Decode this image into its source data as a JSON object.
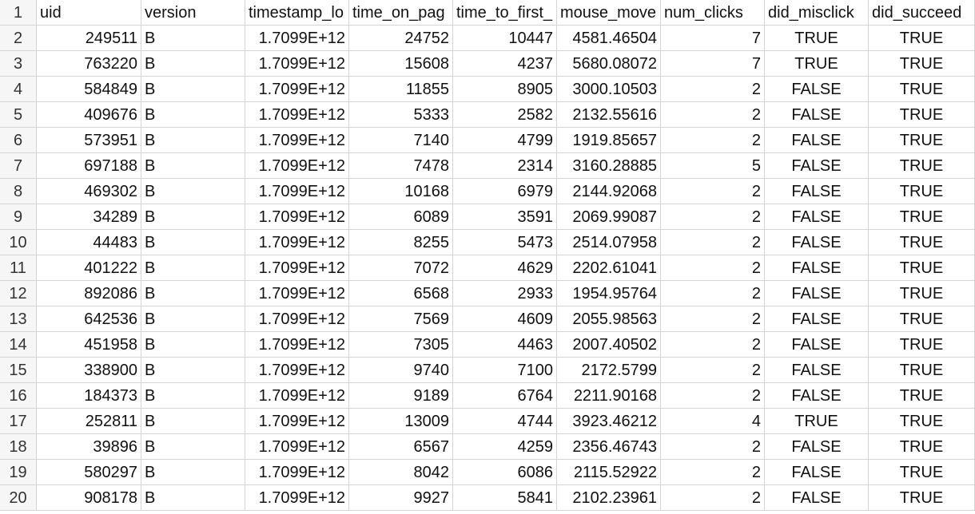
{
  "sheet": {
    "columns": [
      "uid",
      "version",
      "timestamp_lo",
      "time_on_pag",
      "time_to_first_",
      "mouse_move",
      "num_clicks",
      "did_misclick",
      "did_succeed"
    ],
    "rows": [
      [
        "249511",
        "B",
        "1.7099E+12",
        "24752",
        "10447",
        "4581.46504",
        "7",
        "TRUE",
        "TRUE"
      ],
      [
        "763220",
        "B",
        "1.7099E+12",
        "15608",
        "4237",
        "5680.08072",
        "7",
        "TRUE",
        "TRUE"
      ],
      [
        "584849",
        "B",
        "1.7099E+12",
        "11855",
        "8905",
        "3000.10503",
        "2",
        "FALSE",
        "TRUE"
      ],
      [
        "409676",
        "B",
        "1.7099E+12",
        "5333",
        "2582",
        "2132.55616",
        "2",
        "FALSE",
        "TRUE"
      ],
      [
        "573951",
        "B",
        "1.7099E+12",
        "7140",
        "4799",
        "1919.85657",
        "2",
        "FALSE",
        "TRUE"
      ],
      [
        "697188",
        "B",
        "1.7099E+12",
        "7478",
        "2314",
        "3160.28885",
        "5",
        "FALSE",
        "TRUE"
      ],
      [
        "469302",
        "B",
        "1.7099E+12",
        "10168",
        "6979",
        "2144.92068",
        "2",
        "FALSE",
        "TRUE"
      ],
      [
        "34289",
        "B",
        "1.7099E+12",
        "6089",
        "3591",
        "2069.99087",
        "2",
        "FALSE",
        "TRUE"
      ],
      [
        "44483",
        "B",
        "1.7099E+12",
        "8255",
        "5473",
        "2514.07958",
        "2",
        "FALSE",
        "TRUE"
      ],
      [
        "401222",
        "B",
        "1.7099E+12",
        "7072",
        "4629",
        "2202.61041",
        "2",
        "FALSE",
        "TRUE"
      ],
      [
        "892086",
        "B",
        "1.7099E+12",
        "6568",
        "2933",
        "1954.95764",
        "2",
        "FALSE",
        "TRUE"
      ],
      [
        "642536",
        "B",
        "1.7099E+12",
        "7569",
        "4609",
        "2055.98563",
        "2",
        "FALSE",
        "TRUE"
      ],
      [
        "451958",
        "B",
        "1.7099E+12",
        "7305",
        "4463",
        "2007.40502",
        "2",
        "FALSE",
        "TRUE"
      ],
      [
        "338900",
        "B",
        "1.7099E+12",
        "9740",
        "7100",
        "2172.5799",
        "2",
        "FALSE",
        "TRUE"
      ],
      [
        "184373",
        "B",
        "1.7099E+12",
        "9189",
        "6764",
        "2211.90168",
        "2",
        "FALSE",
        "TRUE"
      ],
      [
        "252811",
        "B",
        "1.7099E+12",
        "13009",
        "4744",
        "3923.46212",
        "4",
        "TRUE",
        "TRUE"
      ],
      [
        "39896",
        "B",
        "1.7099E+12",
        "6567",
        "4259",
        "2356.46743",
        "2",
        "FALSE",
        "TRUE"
      ],
      [
        "580297",
        "B",
        "1.7099E+12",
        "8042",
        "6086",
        "2115.52922",
        "2",
        "FALSE",
        "TRUE"
      ],
      [
        "908178",
        "B",
        "1.7099E+12",
        "9927",
        "5841",
        "2102.23961",
        "2",
        "FALSE",
        "TRUE"
      ]
    ]
  }
}
